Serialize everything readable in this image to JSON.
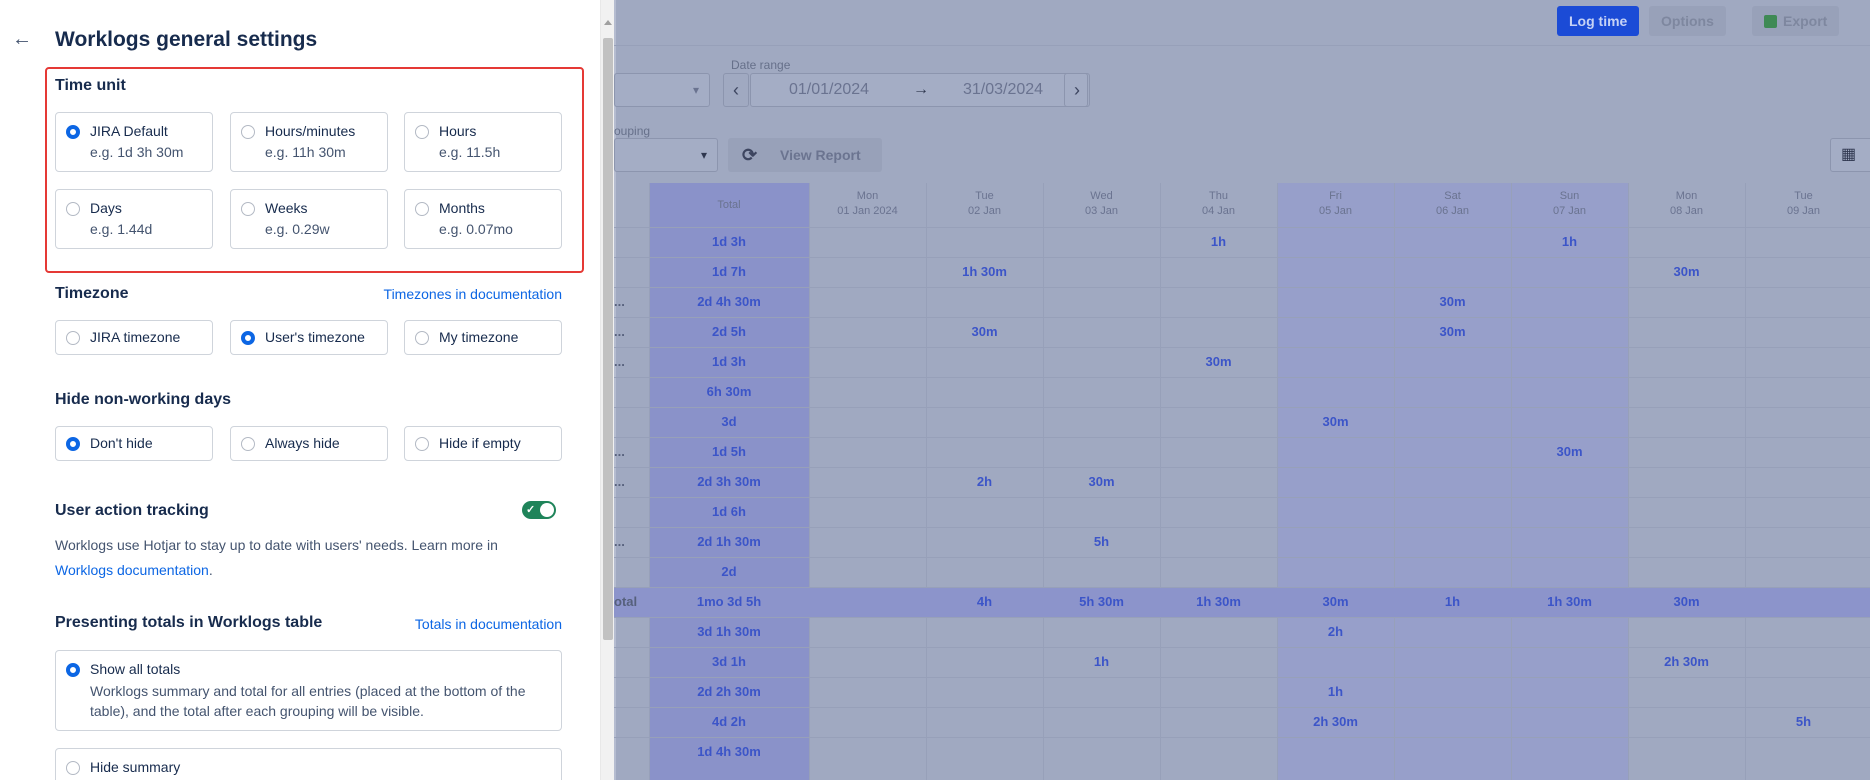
{
  "header": {
    "title": "Worklogs general settings",
    "back_icon": "arrow-left-icon"
  },
  "time_unit": {
    "title": "Time unit",
    "options": [
      {
        "label": "JIRA Default",
        "example": "e.g. 1d 3h 30m",
        "selected": true
      },
      {
        "label": "Hours/minutes",
        "example": "e.g. 11h 30m",
        "selected": false
      },
      {
        "label": "Hours",
        "example": "e.g. 11.5h",
        "selected": false
      },
      {
        "label": "Days",
        "example": "e.g. 1.44d",
        "selected": false
      },
      {
        "label": "Weeks",
        "example": "e.g. 0.29w",
        "selected": false
      },
      {
        "label": "Months",
        "example": "e.g. 0.07mo",
        "selected": false
      }
    ]
  },
  "timezone": {
    "title": "Timezone",
    "link": "Timezones in documentation",
    "options": [
      {
        "label": "JIRA timezone",
        "selected": false
      },
      {
        "label": "User's timezone",
        "selected": true
      },
      {
        "label": "My timezone",
        "selected": false
      }
    ]
  },
  "non_working": {
    "title": "Hide non-working days",
    "options": [
      {
        "label": "Don't hide",
        "selected": true
      },
      {
        "label": "Always hide",
        "selected": false
      },
      {
        "label": "Hide if empty",
        "selected": false
      }
    ]
  },
  "tracking": {
    "title": "User action tracking",
    "enabled": true,
    "desc_before": "Worklogs use Hotjar to stay up to date with users' needs. Learn more in ",
    "desc_link": "Worklogs documentation",
    "desc_after": "."
  },
  "totals": {
    "title": "Presenting totals in Worklogs table",
    "link": "Totals in documentation",
    "options": [
      {
        "label": "Show all totals",
        "desc": "Worklogs summary and total for all entries (placed at the bottom of the table), and the total after each grouping will be visible.",
        "selected": true
      },
      {
        "label": "Hide summary",
        "selected": false
      }
    ]
  },
  "background": {
    "buttons": {
      "log_time": "Log time",
      "options": "Options",
      "export": "Export"
    },
    "date_range_label": "Date range",
    "date_from": "01/01/2024",
    "date_to": "31/03/2024",
    "grouping_label": "ouping",
    "view_report": "View Report",
    "total_header": "Total",
    "days": [
      {
        "day": "Mon",
        "date": "01 Jan 2024"
      },
      {
        "day": "Tue",
        "date": "02 Jan"
      },
      {
        "day": "Wed",
        "date": "03 Jan"
      },
      {
        "day": "Thu",
        "date": "04 Jan"
      },
      {
        "day": "Fri",
        "date": "05 Jan"
      },
      {
        "day": "Sat",
        "date": "06 Jan"
      },
      {
        "day": "Sun",
        "date": "07 Jan"
      },
      {
        "day": "Mon",
        "date": "08 Jan"
      },
      {
        "day": "Tue",
        "date": "09 Jan"
      }
    ],
    "rows": [
      {
        "label": "",
        "total": "1d 3h",
        "cells": [
          "",
          "",
          "",
          "1h",
          "",
          "",
          "1h",
          "",
          ""
        ]
      },
      {
        "label": "",
        "total": "1d 7h",
        "cells": [
          "",
          "1h 30m",
          "",
          "",
          "",
          "",
          "",
          "30m",
          ""
        ]
      },
      {
        "label": "...",
        "total": "2d 4h 30m",
        "cells": [
          "",
          "",
          "",
          "",
          "",
          "30m",
          "",
          "",
          ""
        ]
      },
      {
        "label": "...",
        "total": "2d 5h",
        "cells": [
          "",
          "30m",
          "",
          "",
          "",
          "30m",
          "",
          "",
          ""
        ]
      },
      {
        "label": "...",
        "total": "1d 3h",
        "cells": [
          "",
          "",
          "",
          "30m",
          "",
          "",
          "",
          "",
          ""
        ]
      },
      {
        "label": "",
        "total": "6h 30m",
        "cells": [
          "",
          "",
          "",
          "",
          "",
          "",
          "",
          "",
          ""
        ]
      },
      {
        "label": "",
        "total": "3d",
        "cells": [
          "",
          "",
          "",
          "",
          "30m",
          "",
          "",
          "",
          ""
        ]
      },
      {
        "label": "...",
        "total": "1d 5h",
        "cells": [
          "",
          "",
          "",
          "",
          "",
          "",
          "30m",
          "",
          ""
        ]
      },
      {
        "label": "...",
        "total": "2d 3h 30m",
        "cells": [
          "",
          "2h",
          "30m",
          "",
          "",
          "",
          "",
          "",
          ""
        ]
      },
      {
        "label": "",
        "total": "1d 6h",
        "cells": [
          "",
          "",
          "",
          "",
          "",
          "",
          "",
          "",
          ""
        ]
      },
      {
        "label": "...",
        "total": "2d 1h 30m",
        "cells": [
          "",
          "",
          "5h",
          "",
          "",
          "",
          "",
          "",
          ""
        ]
      },
      {
        "label": "",
        "total": "2d",
        "cells": [
          "",
          "",
          "",
          "",
          "",
          "",
          "",
          "",
          ""
        ]
      },
      {
        "label": "otal",
        "total": "1mo 3d 5h",
        "cells": [
          "",
          "4h",
          "5h 30m",
          "1h 30m",
          "30m",
          "1h",
          "1h 30m",
          "30m",
          ""
        ],
        "summary": true
      },
      {
        "label": "",
        "total": "3d 1h 30m",
        "cells": [
          "",
          "",
          "",
          "",
          "2h",
          "",
          "",
          "",
          ""
        ]
      },
      {
        "label": "",
        "total": "3d 1h",
        "cells": [
          "",
          "",
          "1h",
          "",
          "",
          "",
          "",
          "2h 30m",
          ""
        ]
      },
      {
        "label": "",
        "total": "2d 2h 30m",
        "cells": [
          "",
          "",
          "",
          "",
          "1h",
          "",
          "",
          "",
          ""
        ]
      },
      {
        "label": "",
        "total": "4d 2h",
        "cells": [
          "",
          "",
          "",
          "",
          "2h 30m",
          "",
          "",
          "",
          "5h"
        ]
      },
      {
        "label": "",
        "total": "1d 4h 30m",
        "cells": [
          "",
          "",
          "",
          "",
          "",
          "",
          "",
          "",
          ""
        ]
      }
    ]
  }
}
